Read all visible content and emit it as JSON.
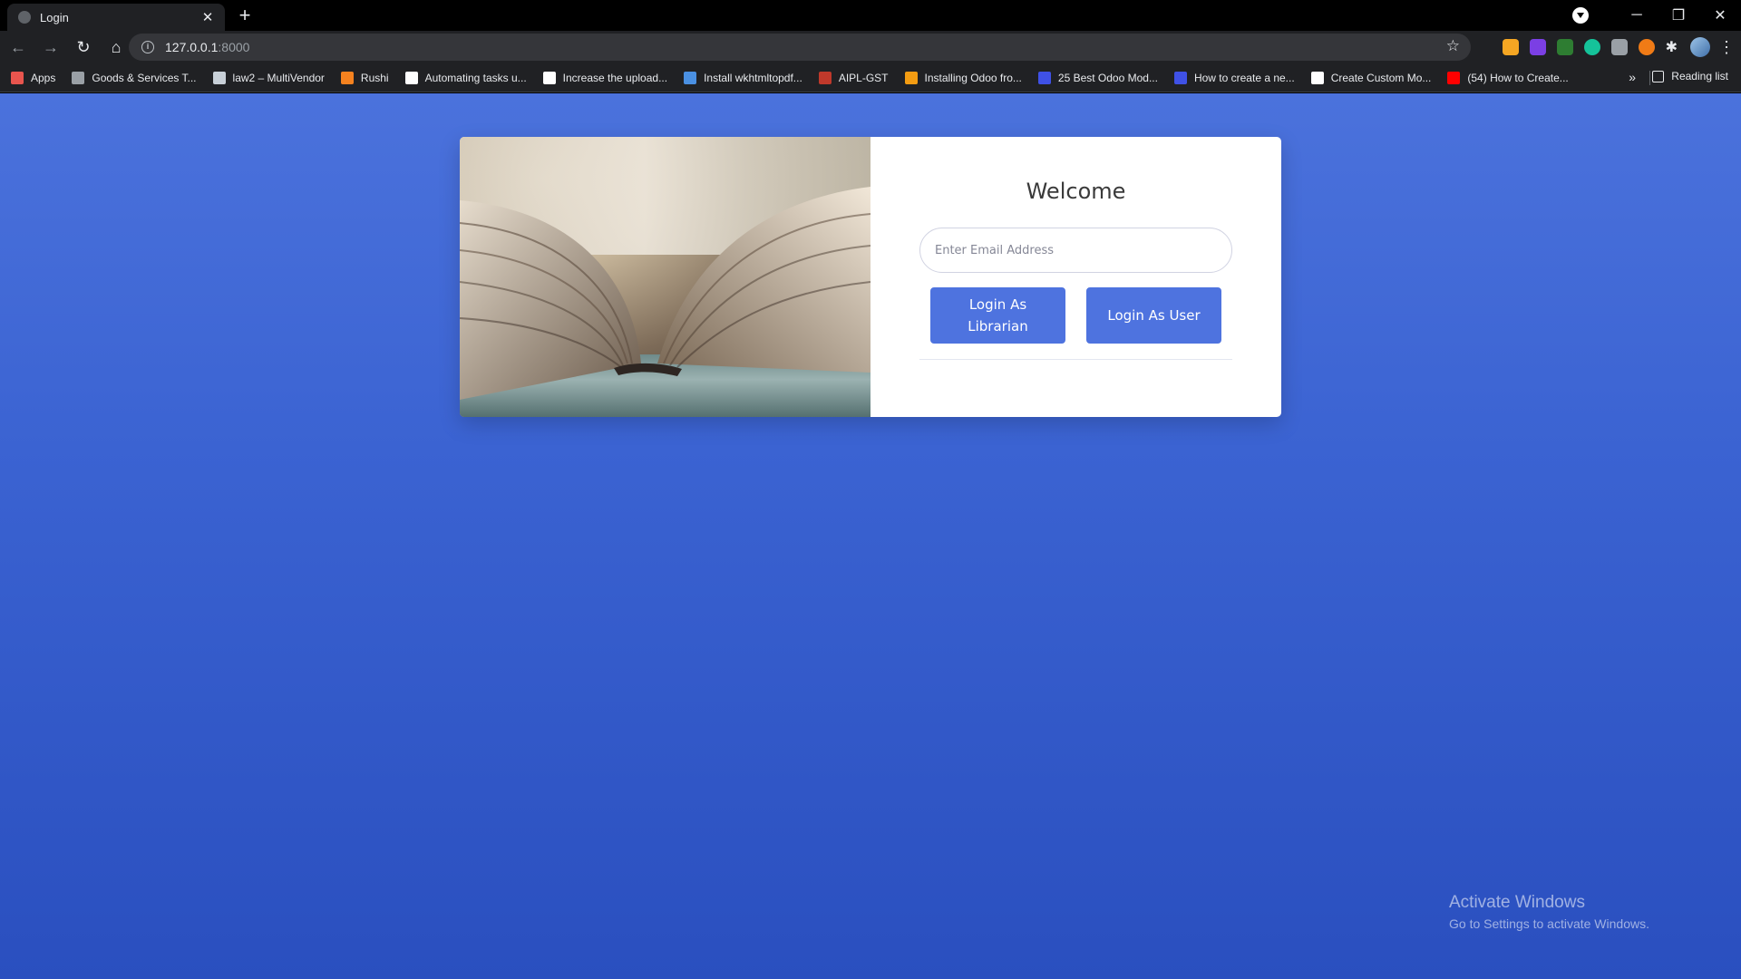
{
  "browser": {
    "tab_title": "Login",
    "tab_close": "✕",
    "new_tab": "+",
    "url_host": "127.0.0.1",
    "url_port": ":8000",
    "window_minimize": "─",
    "window_restore": "❐",
    "window_close": "✕",
    "bookmarks": [
      {
        "label": "Apps",
        "icon": "apps-grid-icon",
        "color": "#e8554e"
      },
      {
        "label": "Goods & Services T...",
        "icon": "gst-icon",
        "color": "#9aa0a6"
      },
      {
        "label": "law2 – MultiVendor",
        "icon": "wordpress-icon",
        "color": "#c8d0d8"
      },
      {
        "label": "Rushi",
        "icon": "rushi-icon",
        "color": "#f5821f"
      },
      {
        "label": "Automating tasks u...",
        "icon": "medium-icon",
        "color": "#ffffff"
      },
      {
        "label": "Increase the upload...",
        "icon": "medium-icon",
        "color": "#ffffff"
      },
      {
        "label": "Install wkhtmltopdf...",
        "icon": "wkhtml-icon",
        "color": "#4a90e2"
      },
      {
        "label": "AIPL-GST",
        "icon": "aipl-icon",
        "color": "#c0392b"
      },
      {
        "label": "Installing Odoo fro...",
        "icon": "odoo-icon",
        "color": "#f39c12"
      },
      {
        "label": "25 Best Odoo Mod...",
        "icon": "webkul-icon",
        "color": "#3f51e6"
      },
      {
        "label": "How to create a ne...",
        "icon": "webkul-icon",
        "color": "#3f51e6"
      },
      {
        "label": "Create Custom Mo...",
        "icon": "medium-icon",
        "color": "#ffffff"
      },
      {
        "label": "(54) How to Create...",
        "icon": "youtube-icon",
        "color": "#ff0000"
      }
    ],
    "bookmarks_overflow": "»",
    "reading_list": "Reading list"
  },
  "page": {
    "welcome": "Welcome",
    "email_placeholder": "Enter Email Address",
    "librarian_button": "Login As Librarian",
    "user_button": "Login As User",
    "accent_color": "#4e73df"
  },
  "os_watermark": {
    "title": "Activate Windows",
    "subtitle": "Go to Settings to activate Windows."
  }
}
